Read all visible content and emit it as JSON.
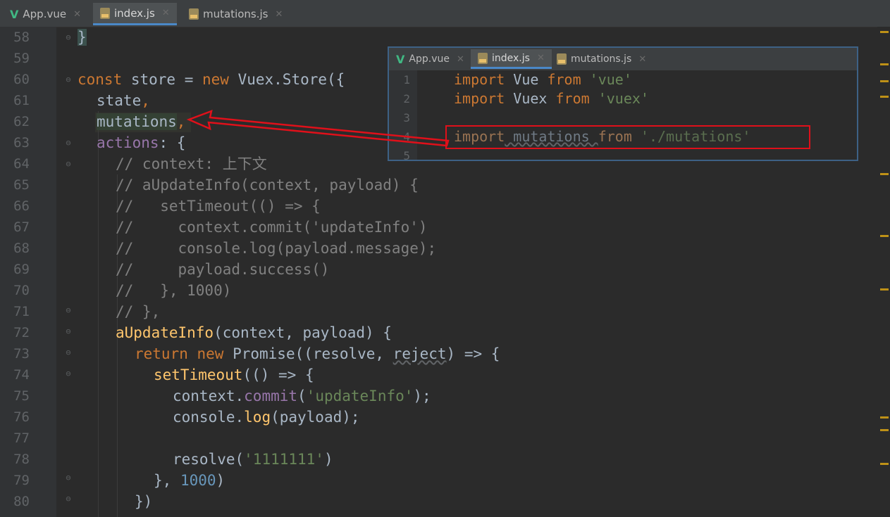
{
  "tabs": [
    {
      "label": "App.vue",
      "icon": "vue-icon",
      "active": false
    },
    {
      "label": "index.js",
      "icon": "js-file-icon",
      "active": true
    },
    {
      "label": "mutations.js",
      "icon": "js-file-icon",
      "active": false
    }
  ],
  "line_numbers": [
    "58",
    "59",
    "60",
    "61",
    "62",
    "63",
    "64",
    "65",
    "66",
    "67",
    "68",
    "69",
    "70",
    "71",
    "72",
    "73",
    "74",
    "75",
    "76",
    "77",
    "78",
    "79",
    "80"
  ],
  "code": {
    "l58": "}",
    "l60_kw": "const",
    "l60_a": " store = ",
    "l60_new": "new",
    "l60_b": " Vuex.Store({",
    "l61": "state",
    "l61_p": ",",
    "l62": "mutations",
    "l62_p": ",",
    "l63_a": "actions",
    "l63_b": ": {",
    "l64": "// context: 上下文",
    "l65": "// aUpdateInfo(context, payload) {",
    "l66": "//   setTimeout(() => {",
    "l67": "//     context.commit('updateInfo')",
    "l68": "//     console.log(payload.message);",
    "l69": "//     payload.success()",
    "l70": "//   }, 1000)",
    "l71": "// },",
    "l72_fn": "aUpdateInfo",
    "l72_b": "(context, payload) {",
    "l73_ret": "return",
    "l73_new": "new",
    "l73_b": " Promise((resolve, ",
    "l73_rej": "reject",
    "l73_c": ") => {",
    "l74_fn": "setTimeout",
    "l74_b": "(() => {",
    "l75_a": "context.",
    "l75_fn": "commit",
    "l75_b": "(",
    "l75_str": "'updateInfo'",
    "l75_c": ");",
    "l76_a": "console.",
    "l76_fn": "log",
    "l76_b": "(payload);",
    "l78_a": "resolve(",
    "l78_str": "'1111111'",
    "l78_b": ")",
    "l79_a": "}, ",
    "l79_num": "1000",
    "l79_b": ")",
    "l80": "})"
  },
  "popup": {
    "tabs": [
      {
        "label": "App.vue",
        "icon": "vue-icon"
      },
      {
        "label": "index.js",
        "icon": "js-file-icon"
      },
      {
        "label": "mutations.js",
        "icon": "js-file-icon"
      }
    ],
    "line_numbers": [
      "1",
      "2",
      "3",
      "4",
      "5"
    ],
    "l1_kw": "import",
    "l1_a": " Vue ",
    "l1_from": "from",
    "l1_str": " 'vue'",
    "l2_kw": "import",
    "l2_a": " Vuex ",
    "l2_from": "from",
    "l2_str": " 'vuex'",
    "l4_kw": "import",
    "l4_a": " mutations ",
    "l4_from": "from",
    "l4_str": " './mutations'"
  },
  "colors": {
    "annotation": "#e0101a",
    "keyword": "#cc7832",
    "string": "#6a8759",
    "number": "#6897bb",
    "function": "#ffc66d",
    "comment": "#808080"
  }
}
